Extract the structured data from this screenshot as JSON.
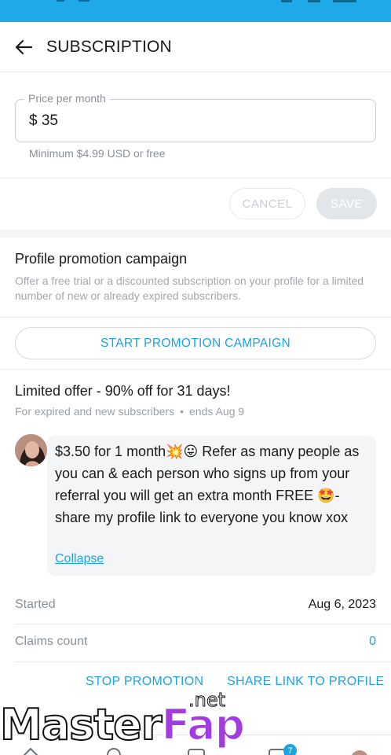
{
  "header": {
    "title": "SUBSCRIPTION"
  },
  "price": {
    "label": "Price per month",
    "value": "$ 35",
    "hint": "Minimum $4.99 USD or free"
  },
  "actions": {
    "cancel": "CANCEL",
    "save": "SAVE"
  },
  "promotion": {
    "title": "Profile promotion campaign",
    "description": "Offer a free trial or a discounted subscription on your profile for a limited number of new or already expired subscribers.",
    "start_button": "START PROMOTION CAMPAIGN"
  },
  "offer": {
    "title": "Limited offer - 90% off for 31 days!",
    "audience": "For expired and new subscribers",
    "ends": "ends Aug 9",
    "message": "$3.50 for 1 month💥😛 Refer as many people as you can & each person who signs up from your referral you will get an extra month FREE 🤩- share my profile link to everyone you know xox",
    "collapse": "Collapse",
    "started_label": "Started",
    "started_value": "Aug 6, 2023",
    "claims_label": "Claims count",
    "claims_value": "0",
    "stop_button": "STOP PROMOTION",
    "share_button": "SHARE LINK TO PROFILE"
  },
  "bottom_nav": {
    "icons": [
      "home-icon",
      "search-icon",
      "add-post-icon",
      "messages-icon",
      "profile-icon"
    ],
    "messages_badge": "7"
  },
  "watermark": {
    "brand": "MasterFap",
    "suffix": ".net"
  },
  "colors": {
    "accent": "#1ea2e0",
    "status_bar": "#1ea9e8"
  }
}
